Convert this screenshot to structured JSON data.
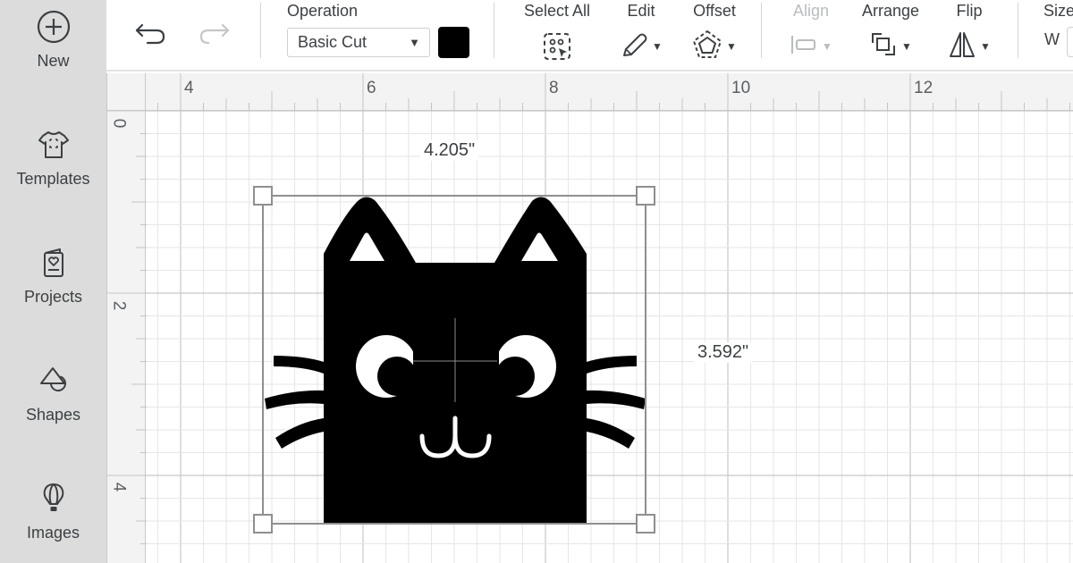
{
  "sidebar": {
    "items": [
      {
        "label": "New",
        "icon": "plus-circle-icon"
      },
      {
        "label": "Templates",
        "icon": "tshirt-icon"
      },
      {
        "label": "Projects",
        "icon": "card-heart-icon"
      },
      {
        "label": "Shapes",
        "icon": "shapes-icon"
      },
      {
        "label": "Images",
        "icon": "hot-air-balloon-icon"
      }
    ]
  },
  "toolbar": {
    "undo_icon": "undo-icon",
    "redo_icon": "redo-icon",
    "operation": {
      "label": "Operation",
      "value": "Basic Cut",
      "color": "#000000"
    },
    "select_all": {
      "label": "Select All",
      "icon": "select-all-icon"
    },
    "edit": {
      "label": "Edit",
      "icon": "pencil-icon"
    },
    "offset": {
      "label": "Offset",
      "icon": "offset-pentagon-icon"
    },
    "align": {
      "label": "Align",
      "icon": "align-icon",
      "disabled": true
    },
    "arrange": {
      "label": "Arrange",
      "icon": "arrange-icon"
    },
    "flip": {
      "label": "Flip",
      "icon": "flip-icon"
    },
    "size": {
      "label": "Size",
      "w_label": "W"
    }
  },
  "canvas": {
    "ruler_top": [
      "4",
      "6",
      "8",
      "10",
      "12"
    ],
    "ruler_left": [
      "0",
      "2",
      "4"
    ],
    "selection": {
      "width_label": "4.205\"",
      "height_label": "3.592\""
    },
    "design": {
      "name": "black cat face",
      "color": "#000000"
    }
  }
}
